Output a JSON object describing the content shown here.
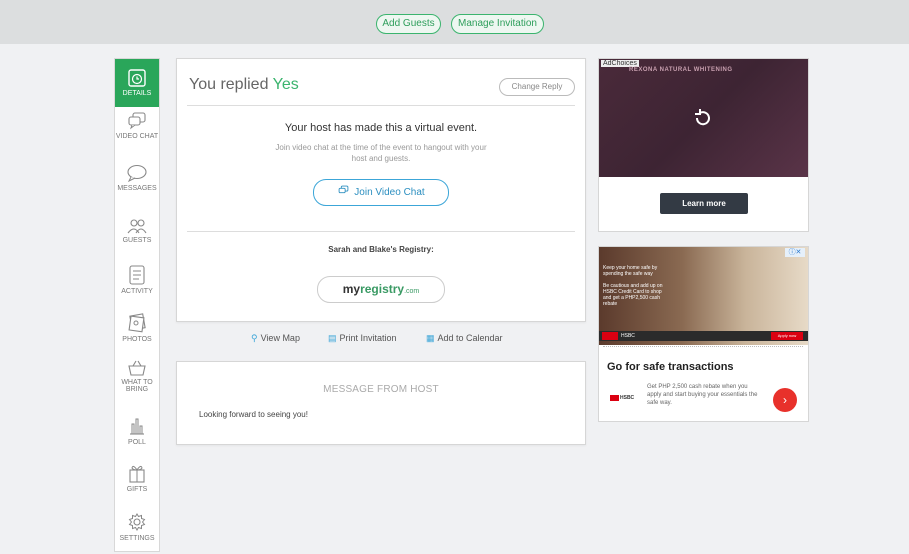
{
  "topbar": {
    "add_guests": "Add Guests",
    "manage_invitation": "Manage Invitation"
  },
  "sidebar": {
    "items": [
      {
        "label": "DETAILS",
        "icon": "clock-icon"
      },
      {
        "label": "VIDEO CHAT",
        "icon": "video-chat-icon"
      },
      {
        "label": "MESSAGES",
        "icon": "speech-bubble-icon"
      },
      {
        "label": "GUESTS",
        "icon": "guests-icon"
      },
      {
        "label": "ACTIVITY",
        "icon": "activity-icon"
      },
      {
        "label": "PHOTOS",
        "icon": "photos-icon"
      },
      {
        "label": "WHAT TO BRING",
        "icon": "basket-icon"
      },
      {
        "label": "POLL",
        "icon": "poll-icon"
      },
      {
        "label": "GIFTS",
        "icon": "gift-icon"
      },
      {
        "label": "SETTINGS",
        "icon": "gear-icon"
      }
    ]
  },
  "rsvp": {
    "prefix": "You replied ",
    "answer": "Yes",
    "change_reply": "Change Reply"
  },
  "virtual_event": {
    "heading": "Your host has made this a virtual event.",
    "description": "Join video chat at the time of the event to hangout with your host and guests.",
    "join_button": "Join Video Chat"
  },
  "registry": {
    "title": "Sarah and Blake's Registry:",
    "logo_my": "my",
    "logo_registry": "registry",
    "logo_com": ".com"
  },
  "links": {
    "view_map": "View Map",
    "print_invitation": "Print Invitation",
    "add_to_calendar": "Add to Calendar"
  },
  "host_message": {
    "title": "MESSAGE FROM HOST",
    "body": "Looking forward to seeing you!"
  },
  "ad1": {
    "adchoices": "AdChoices",
    "brand": "REXONA NATURAL WHITENING",
    "learn_more": "Learn more"
  },
  "ad2": {
    "image_text": "Keep your home safe by spending the safe way",
    "sub_text": "Be cautious and add up on HSBC Credit Card to shop and get a PHP2,500 cash rebate",
    "hsbc": "HSBC",
    "apply": "Apply now",
    "headline": "Go for safe transactions",
    "description": "Get PHP 2,500 cash rebate when you apply and start buying your essentials the safe way.",
    "logo": "HSBC"
  },
  "colors": {
    "brand_green": "#2aa65a",
    "link_blue": "#3ca6d8",
    "hsbc_red": "#db0011"
  }
}
